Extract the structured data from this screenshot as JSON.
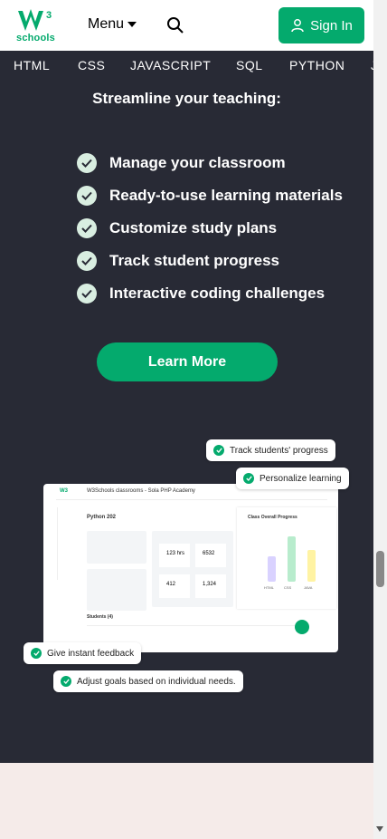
{
  "header": {
    "logo_text": "schools",
    "menu_label": "Menu",
    "signin_label": "Sign In"
  },
  "nav": {
    "items": [
      "HTML",
      "CSS",
      "JAVASCRIPT",
      "SQL",
      "PYTHON",
      "J"
    ]
  },
  "hero": {
    "title": "Streamline your teaching:",
    "features": [
      "Manage your classroom",
      "Ready-to-use learning materials",
      "Customize study plans",
      "Track student progress",
      "Interactive coding challenges"
    ],
    "cta_label": "Learn More"
  },
  "illustration": {
    "window_title": "W3Schools classrooms - Sola PHP Academy",
    "course": "Python 202",
    "chart_title": "Class Overall Progress",
    "students_label": "Students (4)",
    "callouts": {
      "track": "Track students' progress",
      "personalize": "Personalize learning",
      "feedback": "Give instant feedback",
      "goals": "Adjust goals based on individual needs."
    },
    "stats": [
      {
        "value": "123 hrs",
        "label": "Study"
      },
      {
        "value": "6532",
        "label": "Points"
      },
      {
        "value": "412",
        "label": "Lessons"
      },
      {
        "value": "1,324",
        "label": "Challenges"
      }
    ],
    "bars": [
      {
        "label": "HTML",
        "value": 50,
        "color": "#D9D2FF"
      },
      {
        "label": "CSS",
        "value": 90,
        "color": "#B8ECCD"
      },
      {
        "label": "JAVA",
        "value": 62,
        "color": "#FFF3A3"
      }
    ]
  },
  "colors": {
    "brand": "#04AA6D",
    "dark": "#282A35",
    "bottom_bg": "#F5EBE9"
  }
}
